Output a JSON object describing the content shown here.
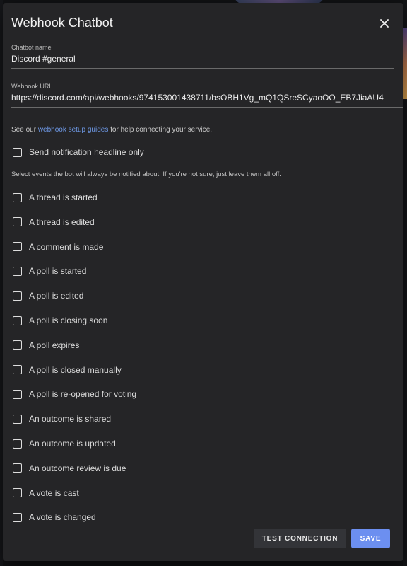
{
  "dialog": {
    "title": "Webhook Chatbot",
    "close_icon": "close-icon"
  },
  "fields": {
    "name": {
      "label": "Chatbot name",
      "value": "Discord #general"
    },
    "url": {
      "label": "Webhook URL",
      "value": "https://discord.com/api/webhooks/974153001438711/bsOBH1Vg_mQ1QSreSCyaoOO_EB7JiaAU4"
    }
  },
  "helper": {
    "prefix": "See our ",
    "link": "webhook setup guides",
    "suffix": " for help connecting your service."
  },
  "headline_only": {
    "label": "Send notification headline only",
    "checked": false
  },
  "events_info": "Select events the bot will always be notified about. If you're not sure, just leave them all off.",
  "events": [
    "A thread is started",
    "A thread is edited",
    "A comment is made",
    "A poll is started",
    "A poll is edited",
    "A poll is closing soon",
    "A poll expires",
    "A poll is closed manually",
    "A poll is re-opened for voting",
    "An outcome is shared",
    "An outcome is updated",
    "An outcome review is due",
    "A vote is cast",
    "A vote is changed"
  ],
  "buttons": {
    "test": "TEST CONNECTION",
    "save": "SAVE"
  },
  "colors": {
    "accent": "#6c8ff0",
    "link": "#6f9ae8",
    "surface": "#252527"
  }
}
